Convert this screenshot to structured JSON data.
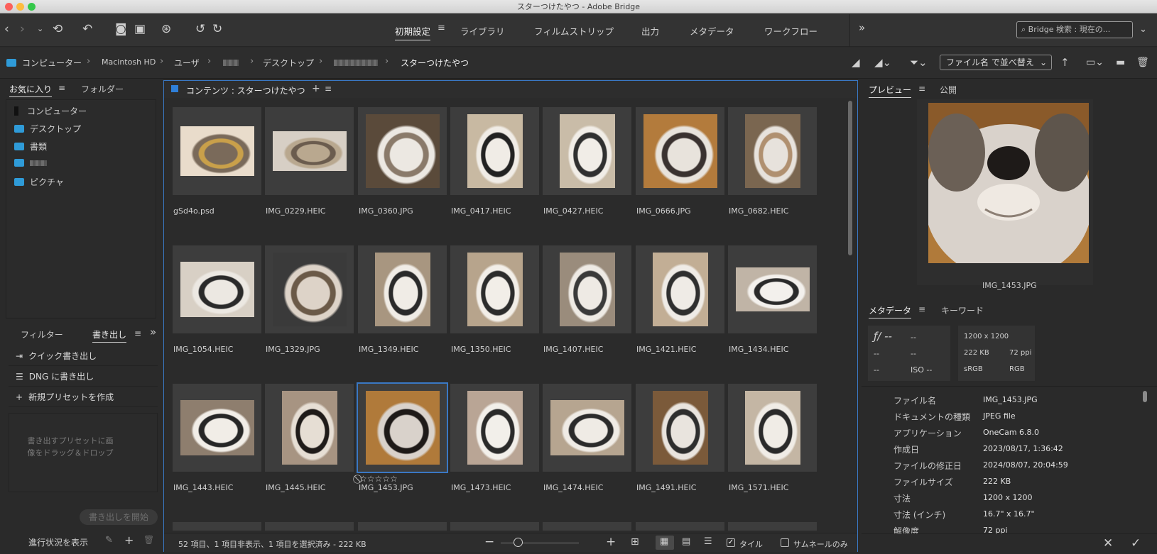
{
  "window": {
    "title": "スターつけたやつ - Adobe Bridge"
  },
  "workspaces": {
    "items": [
      "初期設定",
      "ライブラリ",
      "フィルムストリップ",
      "出力",
      "メタデータ",
      "ワークフロー"
    ],
    "active": "初期設定"
  },
  "search": {
    "placeholder": "Bridge 検索 : 現在の..."
  },
  "breadcrumb": {
    "items": [
      "コンピューター",
      "Macintosh HD",
      "ユーザ",
      "デスクトップ",
      "スターつけたやつ"
    ]
  },
  "sort": {
    "label": "ファイル名 で並べ替え"
  },
  "left_panel": {
    "tabs": [
      "お気に入り",
      "フォルダー"
    ],
    "favorites": [
      "コンピューター",
      "デスクトップ",
      "書類",
      "ピクチャ"
    ]
  },
  "export_panel": {
    "tabs": [
      "フィルター",
      "書き出し"
    ],
    "items": [
      "クイック書き出し",
      "DNG に書き出し",
      "新規プリセットを作成"
    ],
    "drop_hint": "書き出すプリセットに画像をドラッグ＆ドロップ",
    "start_button": "書き出しを開始",
    "progress_label": "進行状況を表示"
  },
  "content": {
    "title": "コンテンツ : スターつけたやつ",
    "files": [
      "gSd4o.psd",
      "IMG_0229.HEIC",
      "IMG_0360.JPG",
      "IMG_0417.HEIC",
      "IMG_0427.HEIC",
      "IMG_0666.JPG",
      "IMG_0682.HEIC",
      "IMG_1054.HEIC",
      "IMG_1329.JPG",
      "IMG_1349.HEIC",
      "IMG_1350.HEIC",
      "IMG_1407.HEIC",
      "IMG_1421.HEIC",
      "IMG_1434.HEIC",
      "IMG_1443.HEIC",
      "IMG_1445.HEIC",
      "IMG_1453.JPG",
      "IMG_1473.HEIC",
      "IMG_1474.HEIC",
      "IMG_1491.HEIC",
      "IMG_1571.HEIC"
    ],
    "selected": "IMG_1453.JPG",
    "rating_stars": "☆☆☆☆☆"
  },
  "status": {
    "summary": "52 項目、1 項目非表示、1 項目を選択済み - 222 KB",
    "tile_label": "タイル",
    "thumb_only_label": "サムネールのみ"
  },
  "preview_panel": {
    "tabs": [
      "プレビュー",
      "公開"
    ],
    "filename": "IMG_1453.JPG"
  },
  "metadata_panel": {
    "tabs": [
      "メタデータ",
      "キーワード"
    ],
    "camera": {
      "f": "ƒ/ --",
      "c1": "--",
      "c2": "--",
      "c3": "--",
      "c4": "--",
      "iso": "ISO --"
    },
    "image": {
      "dims": "1200 x 1200",
      "size": "222 KB",
      "ppi": "72 ppi",
      "profile": "sRGB",
      "mode": "RGB"
    },
    "rows": [
      {
        "label": "ファイル名",
        "value": "IMG_1453.JPG"
      },
      {
        "label": "ドキュメントの種類",
        "value": "JPEG file"
      },
      {
        "label": "アプリケーション",
        "value": "OneCam 6.8.0"
      },
      {
        "label": "作成日",
        "value": "2023/08/17, 1:36:42"
      },
      {
        "label": "ファイルの修正日",
        "value": "2024/08/07, 20:04:59"
      },
      {
        "label": "ファイルサイズ",
        "value": "222 KB"
      },
      {
        "label": "寸法",
        "value": "1200 x 1200"
      },
      {
        "label": "寸法 (インチ)",
        "value": "16.7\" x 16.7\""
      },
      {
        "label": "解像度",
        "value": "72 ppi"
      }
    ]
  },
  "colors": {
    "accent": "#3a78c4",
    "folder": "#2f9bd8"
  }
}
